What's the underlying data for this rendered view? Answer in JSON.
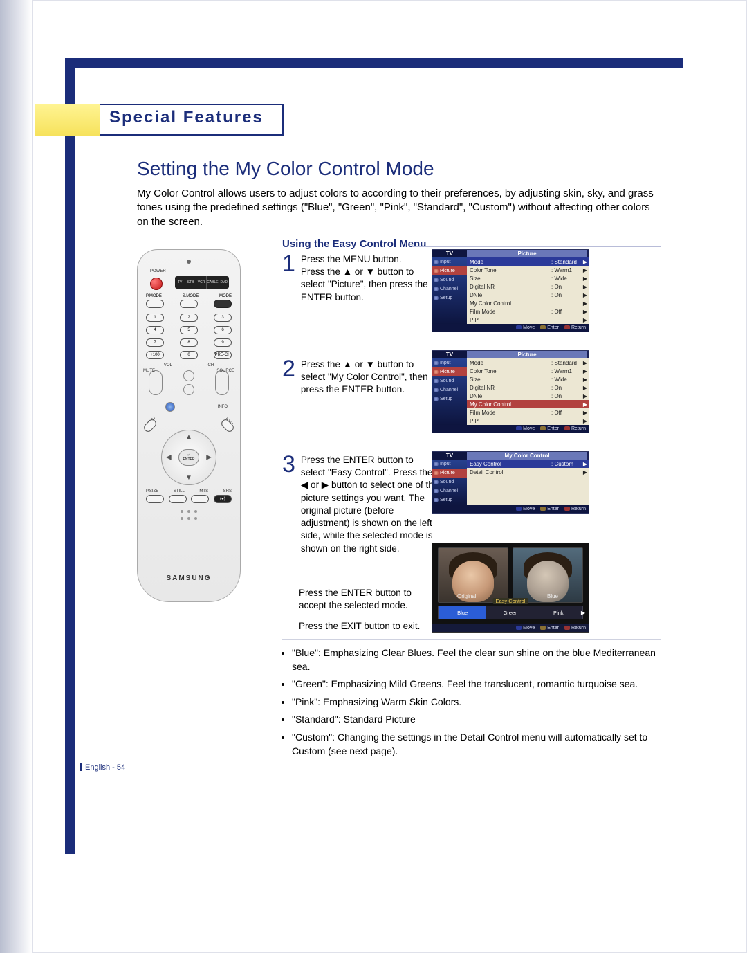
{
  "chapter": "Special Features",
  "title": "Setting the My Color Control Mode",
  "intro": "My Color Control allows users to adjust colors to according to their preferences, by adjusting skin, sky, and grass tones using the predefined settings (\"Blue\", \"Green\", \"Pink\", \"Standard\", \"Custom\") without affecting other colors on the screen.",
  "subhead": "Using the Easy Control Menu",
  "remote": {
    "power": "POWER",
    "strip": [
      "TV",
      "STB",
      "VCR",
      "CABLE",
      "DVD"
    ],
    "row_modes": [
      "P.MODE",
      "S.MODE",
      "MODE"
    ],
    "nums": [
      "1",
      "2",
      "3",
      "4",
      "5",
      "6",
      "7",
      "8",
      "9",
      "+100",
      "0",
      "PRE-CH"
    ],
    "vol": "VOL",
    "ch": "CH",
    "mute": "MUTE",
    "source": "SOURCE",
    "menu": "MENU",
    "info": "INFO",
    "exit": "EXIT",
    "enter_top": "↵",
    "enter_bot": "ENTER",
    "bottom_row": [
      "P.SIZE",
      "STILL",
      "MTS",
      "SRS"
    ],
    "brand": "SAMSUNG"
  },
  "steps": {
    "s1": "Press the MENU button.\nPress the ▲ or ▼ button to select \"Picture\", then press the ENTER button.",
    "s2": "Press the ▲ or ▼ button to select \"My Color Control\", then press the ENTER button.",
    "s3a": "Press the ENTER button to select \"Easy Control\".\nPress the ◀ or ▶ button to select one of the picture settings you want.\nThe original picture (before adjustment) is shown on the left side, while the selected mode is shown on the right side.",
    "s3b": "Press the ENTER button to accept the selected mode.",
    "s3c": "Press the EXIT button to exit."
  },
  "osd_common": {
    "tv": "TV",
    "left": [
      "Input",
      "Picture",
      "Sound",
      "Channel",
      "Setup"
    ],
    "hints": {
      "move": "Move",
      "enter": "Enter",
      "return": "Return"
    }
  },
  "osd1": {
    "title": "Picture",
    "rows": [
      {
        "k": "Mode",
        "v": ": Standard"
      },
      {
        "k": "Color Tone",
        "v": ": Warm1"
      },
      {
        "k": "Size",
        "v": ": Wide"
      },
      {
        "k": "Digital NR",
        "v": ": On"
      },
      {
        "k": "DNIe",
        "v": ": On"
      },
      {
        "k": "My Color Control",
        "v": ""
      },
      {
        "k": "Film Mode",
        "v": ": Off"
      },
      {
        "k": "PIP",
        "v": ""
      }
    ],
    "selected_row": 0
  },
  "osd2": {
    "title": "Picture",
    "rows": [
      {
        "k": "Mode",
        "v": ": Standard"
      },
      {
        "k": "Color Tone",
        "v": ": Warm1"
      },
      {
        "k": "Size",
        "v": ": Wide"
      },
      {
        "k": "Digital NR",
        "v": ": On"
      },
      {
        "k": "DNIe",
        "v": ": On"
      },
      {
        "k": "My Color Control",
        "v": ""
      },
      {
        "k": "Film Mode",
        "v": ": Off"
      },
      {
        "k": "PIP",
        "v": ""
      }
    ],
    "selected_row": 5
  },
  "osd3": {
    "title": "My Color Control",
    "rows": [
      {
        "k": "Easy Control",
        "v": ": Custom"
      },
      {
        "k": "Detail Control",
        "v": ""
      }
    ],
    "selected_row": 0
  },
  "preview": {
    "left_label": "Original",
    "right_label": "Blue",
    "title": "Easy Control",
    "options": [
      "Blue",
      "Green",
      "Pink"
    ],
    "selected": 0,
    "hints": {
      "move": "Move",
      "enter": "Enter",
      "return": "Return"
    }
  },
  "bullets": [
    "\"Blue\": Emphasizing Clear Blues. Feel the clear sun shine on the blue Mediterranean sea.",
    "\"Green\": Emphasizing Mild Greens. Feel the translucent, romantic turquoise sea.",
    "\"Pink\": Emphasizing Warm Skin Colors.",
    "\"Standard\": Standard Picture",
    "\"Custom\": Changing the settings in the Detail Control menu will automatically set to Custom (see next page)."
  ],
  "footer": "English - 54"
}
